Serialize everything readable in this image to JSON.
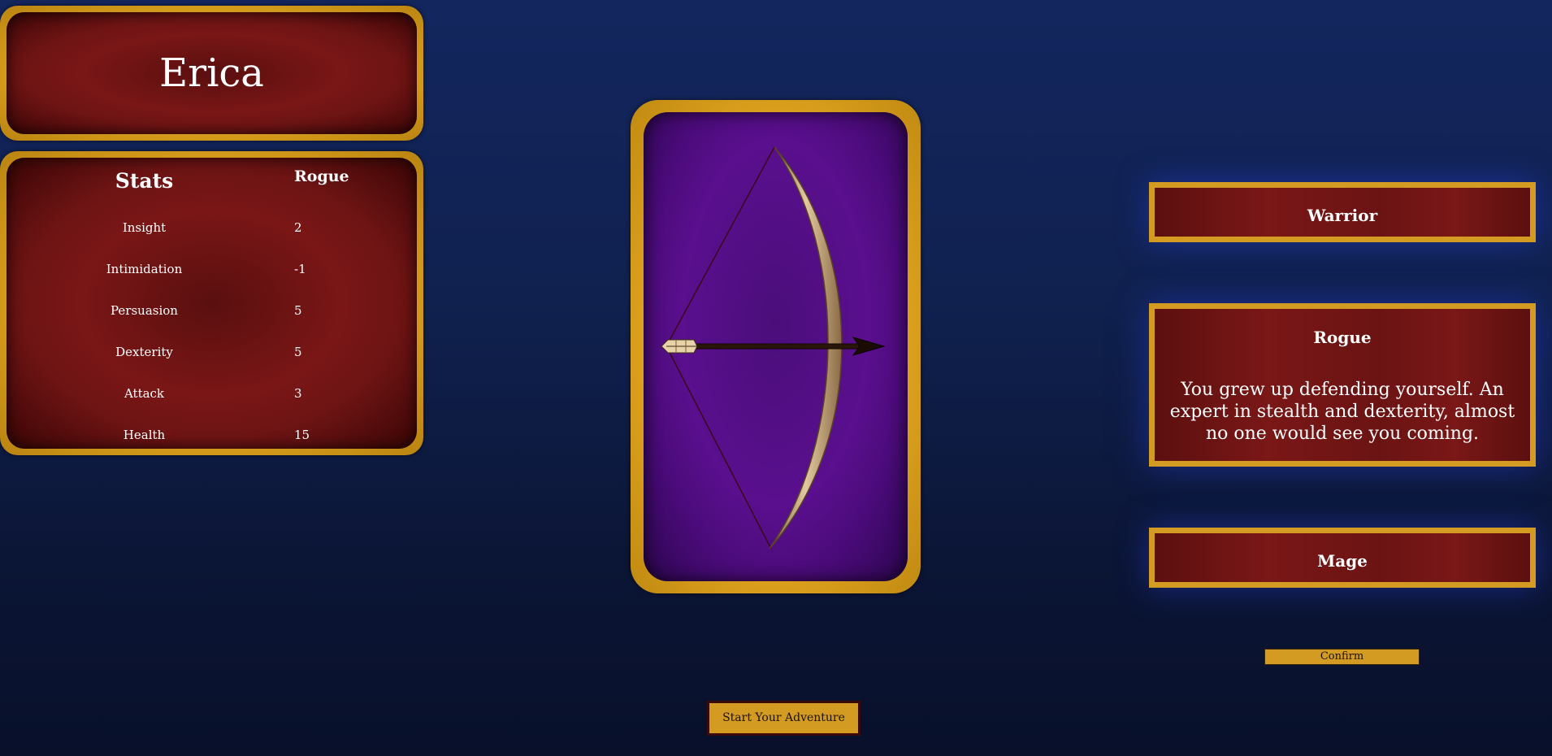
{
  "player": {
    "name": "Erica"
  },
  "stats": {
    "title": "Stats",
    "class_name": "Rogue",
    "rows": [
      {
        "name": "Insight",
        "value": "2"
      },
      {
        "name": "Intimidation",
        "value": "-1"
      },
      {
        "name": "Persuasion",
        "value": "5"
      },
      {
        "name": "Dexterity",
        "value": "5"
      },
      {
        "name": "Attack",
        "value": "3"
      },
      {
        "name": "Health",
        "value": "15"
      }
    ]
  },
  "card": {
    "icon": "bow-and-arrow-icon"
  },
  "classes": {
    "warrior": {
      "label": "Warrior"
    },
    "rogue": {
      "label": "Rogue",
      "description": "You grew up defending yourself. An expert in stealth and dexterity, almost no one would see you coming."
    },
    "mage": {
      "label": "Mage"
    }
  },
  "buttons": {
    "confirm": "Confirm",
    "start": "Start Your Adventure"
  },
  "colors": {
    "gold": "#d39b22",
    "crimson": "#7a1616",
    "card_purple": "#5a0f8e",
    "background": "#10214f"
  }
}
